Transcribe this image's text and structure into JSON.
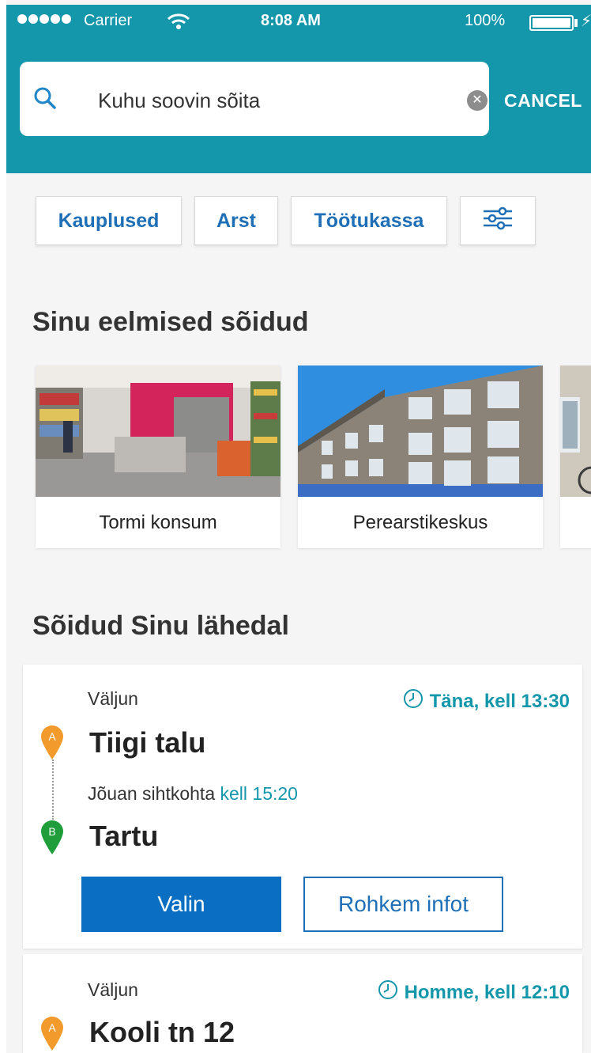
{
  "status_bar": {
    "carrier": "Carrier",
    "time": "8:08 AM",
    "battery": "100%"
  },
  "search": {
    "query": "Kuhu soovin sõita",
    "cancel_label": "CANCEL"
  },
  "chips": [
    {
      "label": "Kauplused"
    },
    {
      "label": "Arst"
    },
    {
      "label": "Töötukassa"
    },
    {
      "label": "",
      "icon": "sliders-icon"
    }
  ],
  "previous": {
    "title": "Sinu eelmised sõidud",
    "places": [
      {
        "label": "Tormi konsum",
        "image": "store-interior-photo"
      },
      {
        "label": "Perearstikeskus",
        "image": "building-photo"
      }
    ]
  },
  "nearby": {
    "title": "Sõidud Sinu lähedal",
    "rides": [
      {
        "depart_label": "Väljun",
        "time": "Täna, kell 13:30",
        "from": "Tiigi talu",
        "arrive_label": "Jõuan sihtkohta",
        "arrive_time": "kell 15:20",
        "to": "Tartu",
        "select_label": "Valin",
        "more_label": "Rohkem infot"
      },
      {
        "depart_label": "Väljun",
        "time": "Homme, kell 12:10",
        "from": "Kooli tn 12"
      }
    ]
  },
  "pins": {
    "a": "A",
    "b": "B"
  },
  "colors": {
    "header": "#1597ab",
    "accent": "#1597ab",
    "primary_button": "#0a6fc2",
    "chip_text": "#1f6fb7",
    "pin_a": "#f39a2d",
    "pin_b": "#1f9d3a"
  }
}
